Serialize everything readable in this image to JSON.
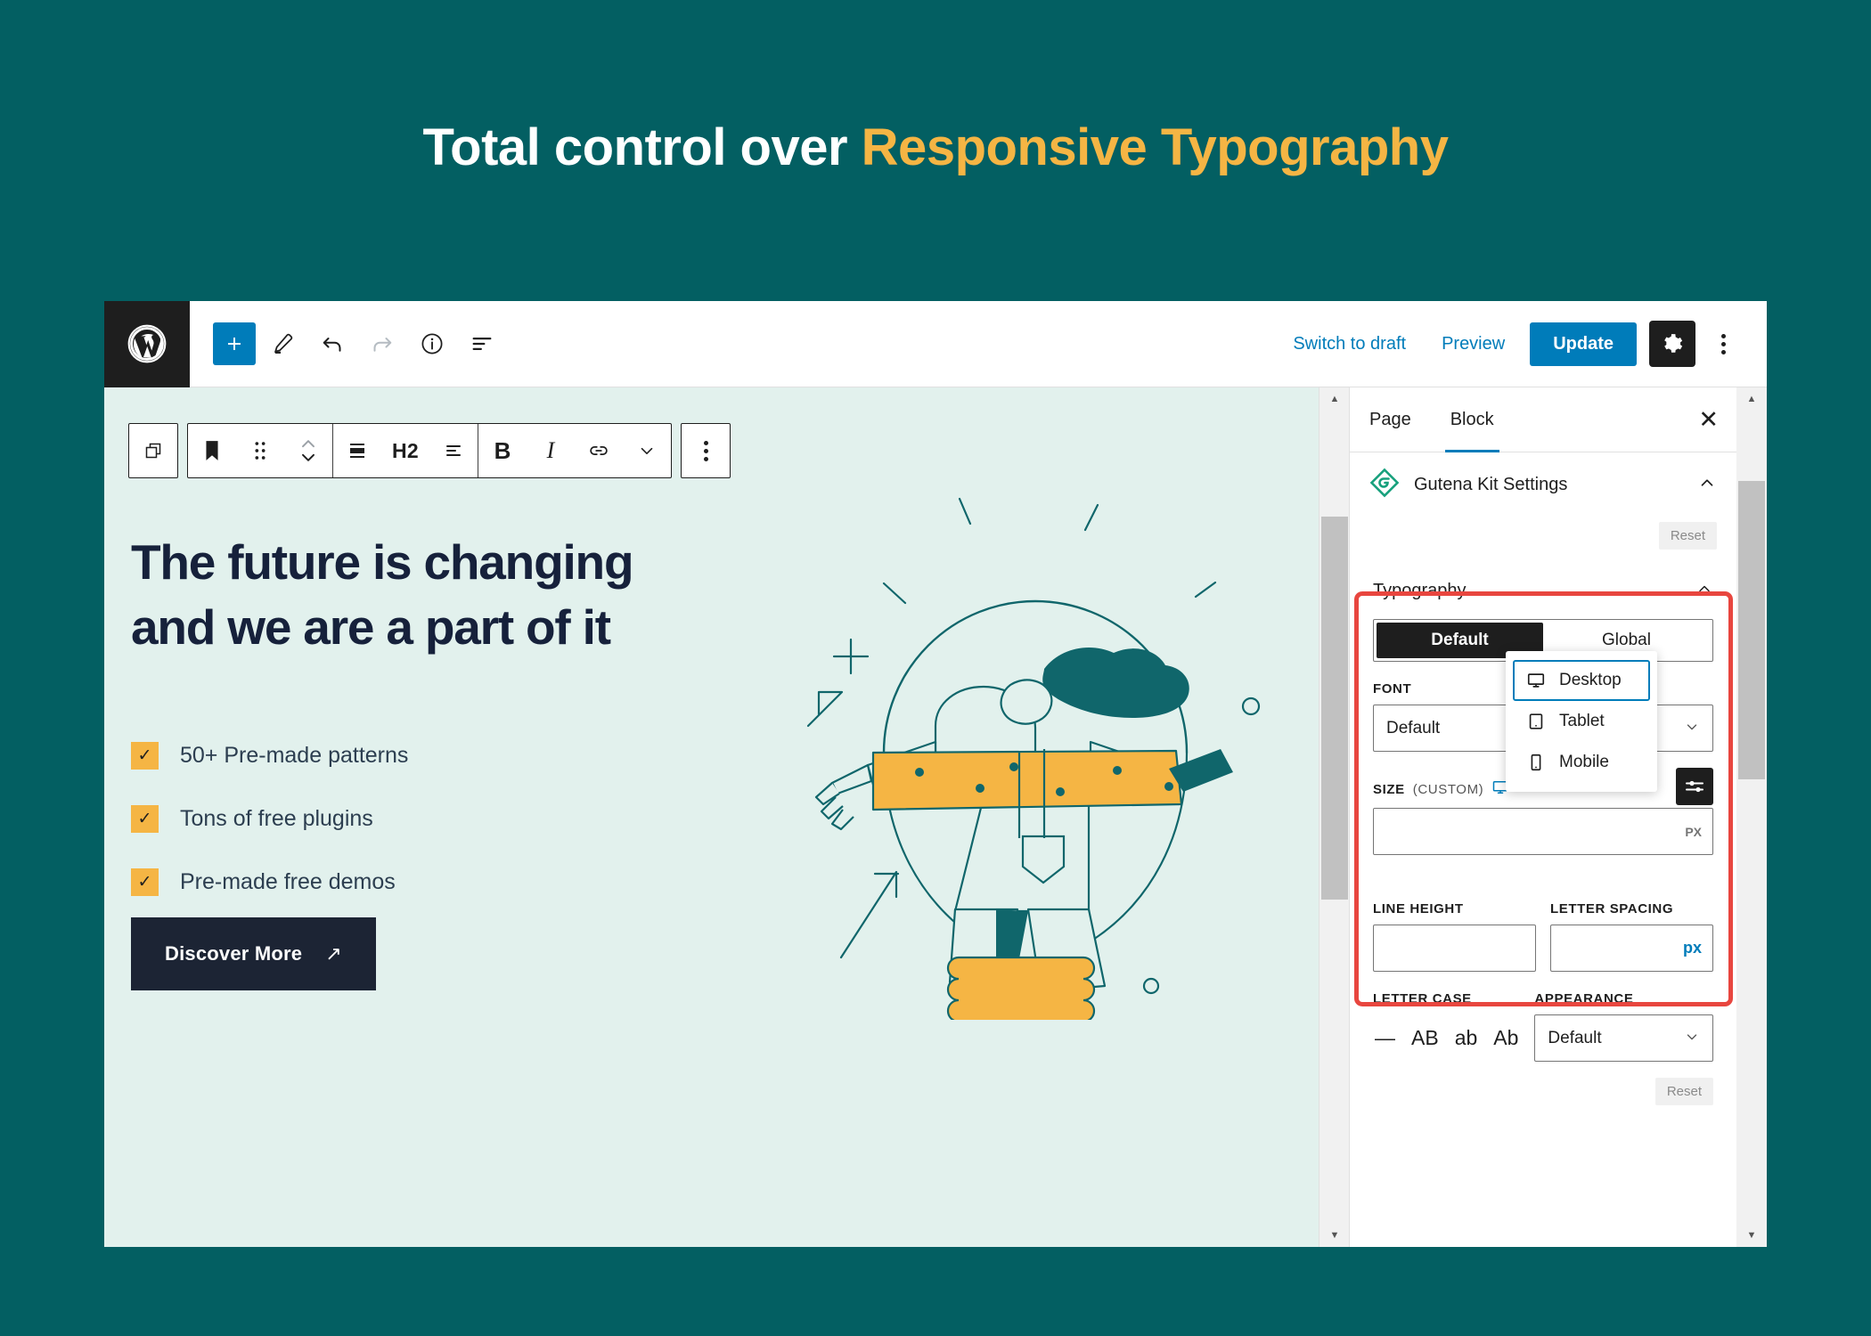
{
  "banner": {
    "heading_plain": "Total control over ",
    "heading_accent": "Responsive Typography",
    "accent_color": "#f5b544",
    "background_color": "#035f62"
  },
  "topbar": {
    "logo_icon": "wordpress-logo-icon",
    "add_block_icon": "plus-icon",
    "tools_icon": "pencil-icon",
    "undo_icon": "undo-arrow-icon",
    "redo_icon": "redo-arrow-icon",
    "details_icon": "info-circle-icon",
    "list_view_icon": "list-view-icon",
    "switch_to_draft_label": "Switch to draft",
    "preview_label": "Preview",
    "update_label": "Update",
    "settings_icon": "gear-icon",
    "more_options_icon": "kebab-menu-icon"
  },
  "block_toolbar": {
    "parent_icon": "parent-block-icon",
    "block_icon": "heading-bookmark-icon",
    "drag_icon": "drag-handle-icon",
    "move_icon": "move-up-down-icon",
    "align_icon": "align-block-icon",
    "block_type_label": "H2",
    "text_align_icon": "text-align-icon",
    "bold_label": "B",
    "italic_label": "I",
    "link_icon": "link-icon",
    "more_formats_icon": "chevron-down-icon",
    "options_icon": "kebab-menu-icon"
  },
  "canvas": {
    "background_color": "#e2f1ed",
    "headline": "The future is changing and we are a part of it",
    "features": [
      {
        "check_icon": "check-icon",
        "label": "50+ Pre-made patterns"
      },
      {
        "check_icon": "check-icon",
        "label": "Tons of free plugins"
      },
      {
        "check_icon": "check-icon",
        "label": "Pre-made free demos"
      }
    ],
    "cta_label": "Discover More",
    "cta_arrow_icon": "arrow-up-right-icon",
    "illustration_name": "person-with-lightbulb-illustration",
    "illustration_colors": {
      "line": "#10666b",
      "fill": "#f5b544",
      "dark": "#10666b"
    }
  },
  "settings_panel": {
    "tabs": [
      {
        "label": "Page",
        "active": false
      },
      {
        "label": "Block",
        "active": true
      }
    ],
    "close_icon": "close-icon",
    "gutena": {
      "logo_icon": "gutena-diamond-icon",
      "title": "Gutena Kit Settings",
      "collapse_icon": "chevron-up-icon",
      "reset_label": "Reset"
    },
    "typography": {
      "title": "Typography",
      "collapse_icon": "chevron-up-icon",
      "segmented": {
        "options": [
          "Default",
          "Global"
        ],
        "selected": "Default"
      },
      "font_label": "FONT",
      "font_value": "Default",
      "font_chevron_icon": "chevron-down-icon",
      "size_label": "SIZE",
      "size_sub_label": "(CUSTOM)",
      "size_device_icon": "desktop-monitor-icon",
      "size_units_icon": "sliders-icon",
      "size_value": "",
      "size_unit": "PX",
      "line_height_label": "LINE HEIGHT",
      "line_height_value": "",
      "letter_spacing_label": "LETTER SPACING",
      "letter_spacing_value": "",
      "letter_spacing_unit": "px",
      "letter_case_label": "LETTER CASE",
      "letter_case_options": [
        "—",
        "AB",
        "ab",
        "Ab"
      ],
      "appearance_label": "APPEARANCE",
      "appearance_value": "Default",
      "appearance_chevron_icon": "chevron-down-icon",
      "reset_label": "Reset",
      "highlight_color": "#e8463f"
    },
    "device_dropdown": {
      "items": [
        {
          "label": "Desktop",
          "icon": "desktop-monitor-icon",
          "selected": true
        },
        {
          "label": "Tablet",
          "icon": "tablet-icon",
          "selected": false
        },
        {
          "label": "Mobile",
          "icon": "mobile-phone-icon",
          "selected": false
        }
      ]
    }
  },
  "scrollbars": {
    "canvas_scrollbar": "vertical-scrollbar",
    "panel_scrollbar": "vertical-scrollbar",
    "up_arrow_icon": "triangle-up-icon",
    "down_arrow_icon": "triangle-down-icon"
  }
}
